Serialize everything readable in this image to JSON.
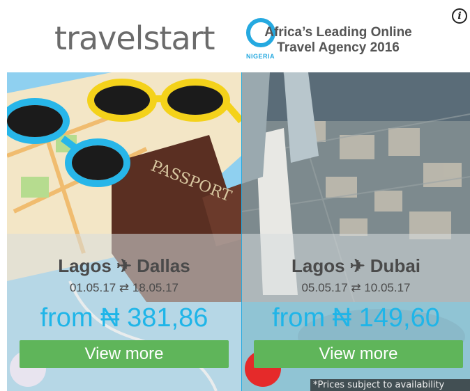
{
  "brand": {
    "logo_text": "travelstart",
    "logo_sub": "NIGERIA",
    "tagline_line1": "Africa’s Leading Online",
    "tagline_line2": "Travel Agency 2016",
    "accent": "#25a9e0"
  },
  "info_icon": "i",
  "deals": [
    {
      "route": "Lagos ✈ Dallas",
      "dates": "01.05.17 ⇄ 18.05.17",
      "price": "from ₦ 381,86",
      "button": "View more"
    },
    {
      "route": "Lagos ✈ Dubai",
      "dates": "05.05.17 ⇄ 10.05.17",
      "price": "from ₦ 149,60",
      "button": "View more"
    }
  ],
  "disclaimer": "*Prices subject to availability",
  "colors": {
    "price": "#1fb5e8",
    "button": "#5fb55a"
  }
}
